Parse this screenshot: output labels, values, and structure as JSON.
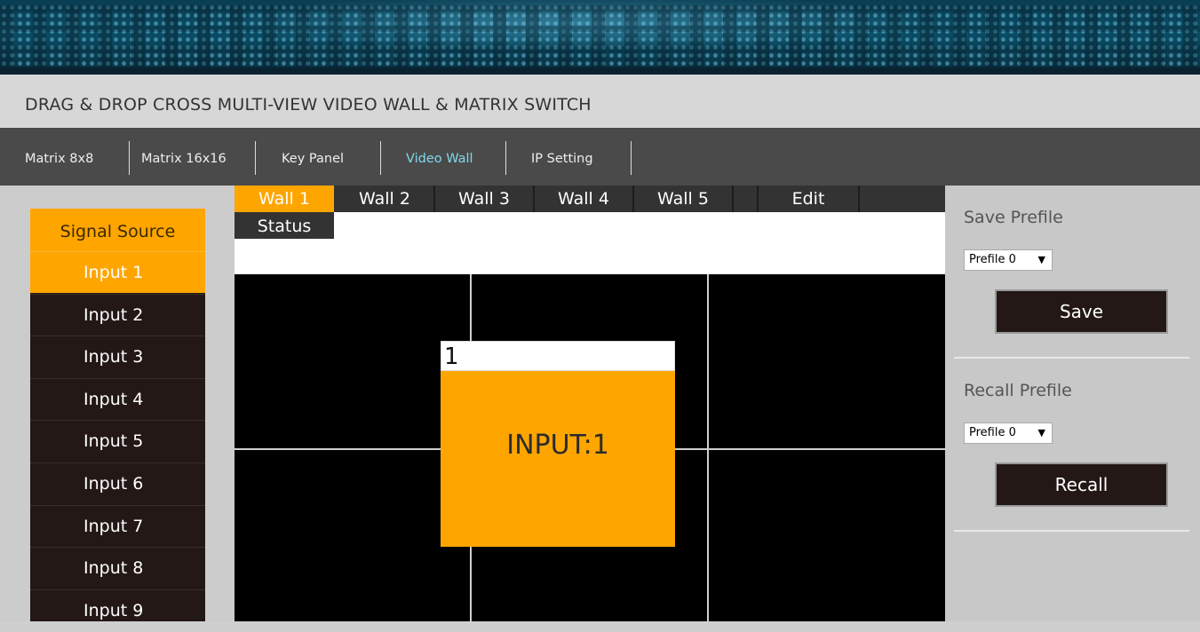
{
  "header": {
    "title": "DRAG & DROP CROSS MULTI-VIEW VIDEO WALL & MATRIX SWITCH"
  },
  "nav": {
    "items": [
      {
        "label": "Matrix 8x8"
      },
      {
        "label": "Matrix 16x16"
      },
      {
        "label": "Key Panel"
      },
      {
        "label": "Video Wall",
        "active": true
      },
      {
        "label": "IP Setting"
      }
    ]
  },
  "sidebar": {
    "header": "Signal Source",
    "inputs": [
      "Input 1",
      "Input 2",
      "Input 3",
      "Input 4",
      "Input 5",
      "Input 6",
      "Input 7",
      "Input 8",
      "Input 9"
    ],
    "active_index": 0
  },
  "wall_tabs": {
    "tabs": [
      "Wall 1",
      "Wall 2",
      "Wall 3",
      "Wall 4",
      "Wall 5"
    ],
    "active": "Wall 1",
    "edit_label": "Edit",
    "status_label": "Status"
  },
  "video_window": {
    "title": "1",
    "label": "INPUT:1"
  },
  "right_panel": {
    "save_label": "Save Prefile",
    "save_select": "Prefile 0",
    "save_button": "Save",
    "recall_label": "Recall Prefile",
    "recall_select": "Prefile 0",
    "recall_button": "Recall"
  },
  "colors": {
    "accent": "#ffa500",
    "dark": "#231816",
    "nav_bg": "#4a4a4a",
    "nav_active": "#7fd8ec"
  },
  "icons": {
    "caret": "caret-down-icon"
  }
}
